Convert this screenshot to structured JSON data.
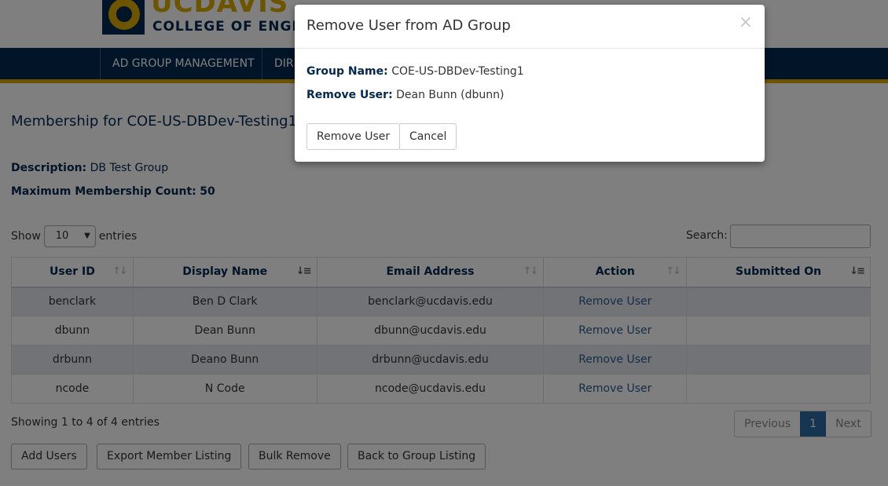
{
  "brand": {
    "logo_line1": "UCDAVIS",
    "logo_line2": "COLLEGE OF ENGINEERING",
    "colors": {
      "navy": "#022851",
      "gold": "#daaa00",
      "link": "#2a5b8c",
      "pager_active": "#2b6aa3"
    }
  },
  "nav": {
    "items": [
      {
        "label": "AD GROUP MANAGEMENT"
      },
      {
        "label": "DIRECTORY"
      }
    ]
  },
  "page": {
    "title": "Membership for COE-US-DBDev-Testing1",
    "description_label": "Description:",
    "description_value": "DB Test Group",
    "max_count_label": "Maximum Membership Count:",
    "max_count_value": "50"
  },
  "table_controls": {
    "show_label": "Show",
    "page_size": "10",
    "entries_label": "entries",
    "search_label": "Search:",
    "search_value": ""
  },
  "table": {
    "columns": [
      "User ID",
      "Display Name",
      "Email Address",
      "Action",
      "Submitted On"
    ],
    "rows": [
      {
        "user_id": "benclark",
        "display_name": "Ben D Clark",
        "email": "benclark@ucdavis.edu",
        "action": "Remove User",
        "submitted_on": ""
      },
      {
        "user_id": "dbunn",
        "display_name": "Dean Bunn",
        "email": "dbunn@ucdavis.edu",
        "action": "Remove User",
        "submitted_on": ""
      },
      {
        "user_id": "drbunn",
        "display_name": "Deano Bunn",
        "email": "drbunn@ucdavis.edu",
        "action": "Remove User",
        "submitted_on": ""
      },
      {
        "user_id": "ncode",
        "display_name": "N Code",
        "email": "ncode@ucdavis.edu",
        "action": "Remove User",
        "submitted_on": ""
      }
    ]
  },
  "footer": {
    "info": "Showing 1 to 4 of 4 entries",
    "pager": {
      "previous": "Previous",
      "current": "1",
      "next": "Next"
    }
  },
  "actions": {
    "add_users": "Add Users",
    "export": "Export Member Listing",
    "bulk_remove": "Bulk Remove",
    "back": "Back to Group Listing"
  },
  "modal": {
    "title": "Remove User from AD Group",
    "close_glyph": "×",
    "group_name_label": "Group Name:",
    "group_name_value": "COE-US-DBDev-Testing1",
    "remove_user_label": "Remove User:",
    "remove_user_value": "Dean Bunn (dbunn)",
    "confirm_button": "Remove User",
    "cancel_button": "Cancel"
  }
}
